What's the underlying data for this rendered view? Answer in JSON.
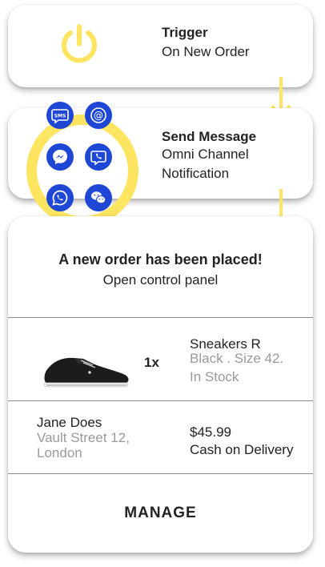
{
  "trigger": {
    "title": "Trigger",
    "event": "On New Order",
    "icon": "power-icon"
  },
  "send_message": {
    "title": "Send Message",
    "line1": "Omni Channel",
    "line2": "Notification",
    "channels": [
      "sms-icon",
      "email-at-icon",
      "messenger-icon",
      "viber-icon",
      "whatsapp-icon",
      "wechat-icon"
    ]
  },
  "order": {
    "title": "A new order has been placed!",
    "subtitle": "Open control panel",
    "item": {
      "quantity": "1x",
      "name": "Sneakers R",
      "variant": "Black . Size 42.",
      "stock": "In Stock"
    },
    "customer": {
      "name": "Jane Does",
      "address": "Vault Street 12, London"
    },
    "price": "$45.99",
    "payment": "Cash on Delivery",
    "manage_label": "MANAGE"
  },
  "colors": {
    "accent_yellow": "#fde562",
    "channel_blue": "#1f47d6",
    "muted_text": "#9a9a9a"
  }
}
